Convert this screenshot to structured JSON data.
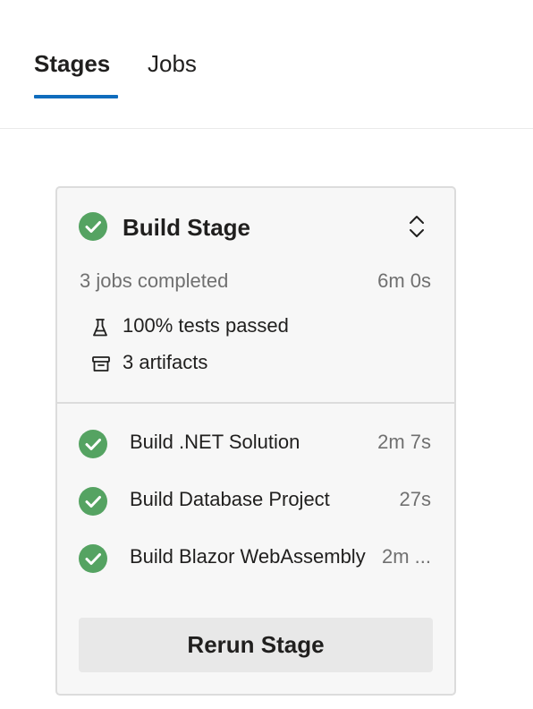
{
  "tabs": [
    {
      "label": "Stages",
      "active": true
    },
    {
      "label": "Jobs",
      "active": false
    }
  ],
  "accent_color": "#0f6cbd",
  "success_color": "#55a362",
  "stage": {
    "title": "Build Stage",
    "status_icon": "success-check-icon",
    "expand_icon": "expand-collapse-icon",
    "jobs_completed": "3 jobs completed",
    "duration": "6m 0s",
    "tests": {
      "icon": "flask-icon",
      "label": "100% tests passed"
    },
    "artifacts": {
      "icon": "artifact-box-icon",
      "label": "3 artifacts"
    },
    "jobs": [
      {
        "name": "Build .NET Solution",
        "duration": "2m 7s",
        "status": "succeeded"
      },
      {
        "name": "Build Database Project",
        "duration": "27s",
        "status": "succeeded"
      },
      {
        "name": "Build Blazor WebAssembly",
        "duration": "2m ...",
        "status": "succeeded"
      }
    ],
    "rerun_label": "Rerun Stage"
  }
}
